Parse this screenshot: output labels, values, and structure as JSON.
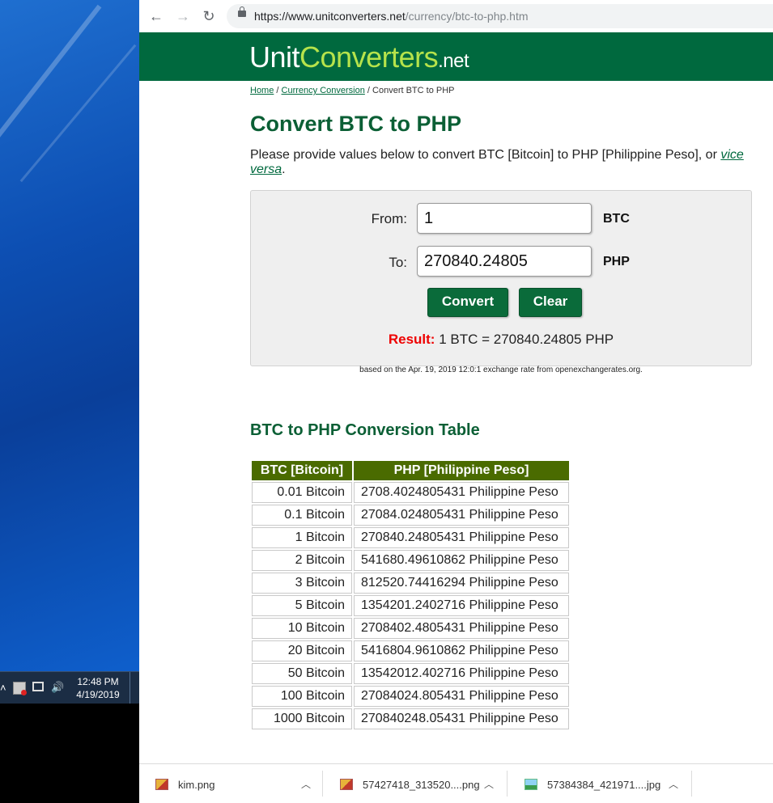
{
  "browser": {
    "url_host": "https://www.unitconverters.net",
    "url_path": "/currency/btc-to-php.htm"
  },
  "site": {
    "logo_unit": "Unit",
    "logo_converters": "Converters",
    "logo_net": ".net"
  },
  "breadcrumb": {
    "home": "Home",
    "sep1": " / ",
    "category": "Currency Conversion",
    "sep2": " / ",
    "current": "Convert BTC to PHP"
  },
  "page": {
    "title": "Convert BTC to PHP",
    "intro_text": "Please provide values below to convert BTC [Bitcoin] to PHP [Philippine Peso], or ",
    "intro_link": "vice versa",
    "intro_end": "."
  },
  "converter": {
    "from_label": "From:",
    "from_value": "1",
    "from_unit": "BTC",
    "to_label": "To:",
    "to_value": "270840.24805",
    "to_unit": "PHP",
    "convert_label": "Convert",
    "clear_label": "Clear",
    "result_label": "Result:",
    "result_text": " 1 BTC = 270840.24805 PHP",
    "rate_note": "based on the Apr. 19, 2019 12:0:1 exchange rate from openexchangerates.org."
  },
  "table": {
    "title": "BTC to PHP Conversion Table",
    "headers": [
      "BTC [Bitcoin]",
      "PHP [Philippine Peso]"
    ],
    "rows": [
      [
        "0.01 Bitcoin",
        "2708.4024805431 Philippine Peso"
      ],
      [
        "0.1 Bitcoin",
        "27084.024805431 Philippine Peso"
      ],
      [
        "1 Bitcoin",
        "270840.24805431 Philippine Peso"
      ],
      [
        "2 Bitcoin",
        "541680.49610862 Philippine Peso"
      ],
      [
        "3 Bitcoin",
        "812520.74416294 Philippine Peso"
      ],
      [
        "5 Bitcoin",
        "1354201.2402716 Philippine Peso"
      ],
      [
        "10 Bitcoin",
        "2708402.4805431 Philippine Peso"
      ],
      [
        "20 Bitcoin",
        "5416804.9610862 Philippine Peso"
      ],
      [
        "50 Bitcoin",
        "13542012.402716 Philippine Peso"
      ],
      [
        "100 Bitcoin",
        "27084024.805431 Philippine Peso"
      ],
      [
        "1000 Bitcoin",
        "270840248.05431 Philippine Peso"
      ]
    ]
  },
  "taskbar": {
    "time": "12:48 PM",
    "date": "4/19/2019"
  },
  "downloads": [
    {
      "name": "kim.png",
      "icon": "image-file-icon"
    },
    {
      "name": "57427418_313520....png",
      "icon": "image-file-icon"
    },
    {
      "name": "57384384_421971....jpg",
      "icon": "jpg-file-icon"
    }
  ]
}
